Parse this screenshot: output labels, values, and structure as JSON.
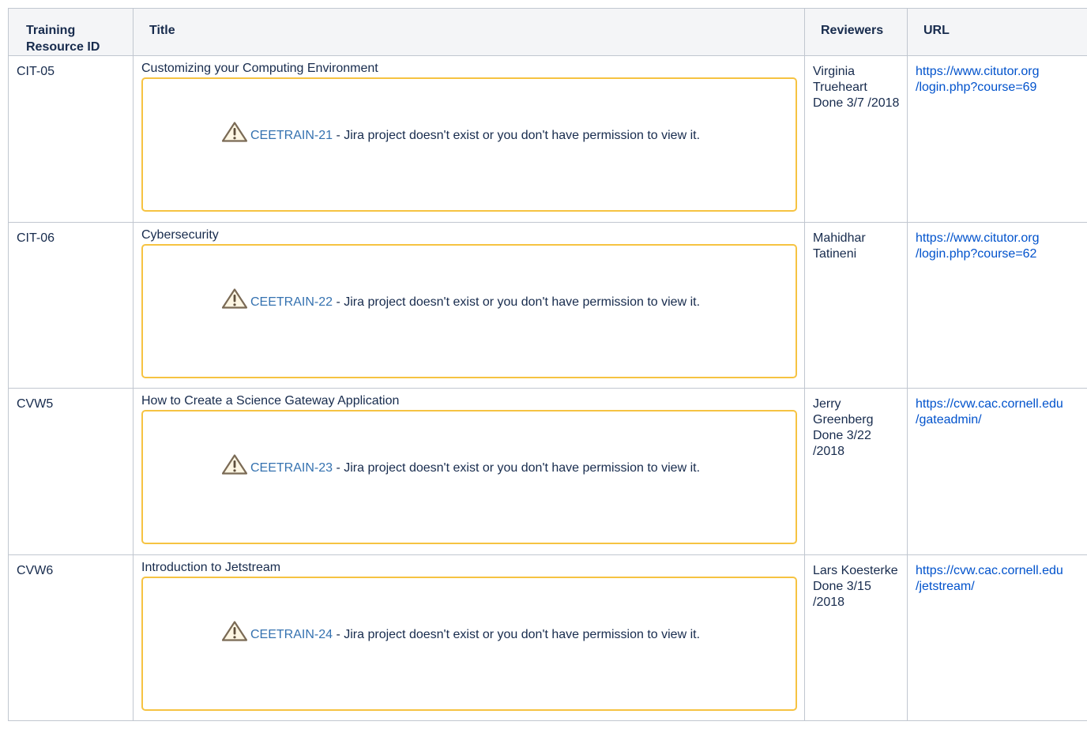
{
  "table": {
    "headers": {
      "id": "Training Resource ID",
      "title": "Title",
      "reviewers": "Reviewers",
      "url": "URL"
    },
    "rows": [
      {
        "id": "CIT-05",
        "title": "Customizing your Computing Environment",
        "jira_key": "CEETRAIN-21",
        "jira_message": " - Jira project doesn't exist or you don't have permission to view it.",
        "reviewers": "Virginia Trueheart Done 3/7 /2018",
        "url": "https://www.citutor.org /login.php?course=69"
      },
      {
        "id": "CIT-06",
        "title": "Cybersecurity",
        "jira_key": "CEETRAIN-22",
        "jira_message": " - Jira project doesn't exist or you don't have permission to view it.",
        "reviewers": "Mahidhar Tatineni",
        "url": "https://www.citutor.org /login.php?course=62"
      },
      {
        "id": "CVW5",
        "title": "How to Create a Science Gateway Application",
        "jira_key": "CEETRAIN-23",
        "jira_message": " - Jira project doesn't exist or you don't have permission to view it.",
        "reviewers": "Jerry Greenberg Done 3/22 /2018",
        "url": "https://cvw.cac.cornell.edu /gateadmin/"
      },
      {
        "id": "CVW6",
        "title": "Introduction to Jetstream",
        "jira_key": "CEETRAIN-24",
        "jira_message": " - Jira project doesn't exist or you don't have permission to view it.",
        "reviewers": "Lars Koesterke Done 3/15 /2018",
        "url": "https://cvw.cac.cornell.edu /jetstream/"
      }
    ]
  },
  "icons": {
    "jira_warning": "warning-icon"
  },
  "colors": {
    "link": "#0052cc",
    "jira_key": "#3572b0",
    "jira_border": "#f6c342",
    "header_bg": "#f4f5f7",
    "border": "#c1c7d0"
  }
}
